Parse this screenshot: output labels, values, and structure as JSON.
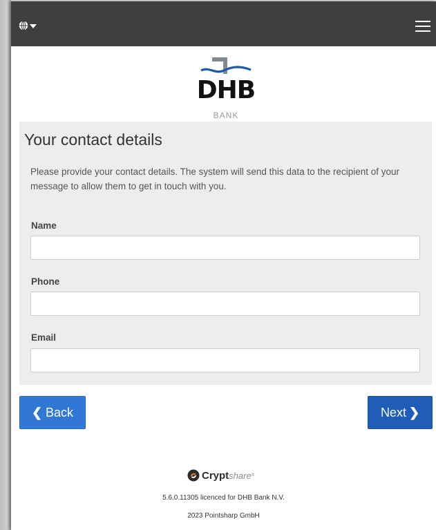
{
  "topbar": {
    "language_icon": "globe-icon",
    "language_caret_icon": "caret-down-icon",
    "menu_icon": "hamburger-menu-icon",
    "background": "#3f3f3f"
  },
  "logo": {
    "name": "DHB",
    "sub": "BANK"
  },
  "form": {
    "title": "Your contact details",
    "description": "Please provide your contact details. The system will send this data to the recipient of your message to allow them to get in touch with you.",
    "fields": [
      {
        "label": "Name",
        "value": ""
      },
      {
        "label": "Phone",
        "value": ""
      },
      {
        "label": "Email",
        "value": ""
      }
    ]
  },
  "buttons": {
    "back_label": "Back",
    "next_label": "Next",
    "back_icon": "chevron-left-icon",
    "next_icon": "chevron-right-icon",
    "back_color": "#3077d6",
    "next_color": "#1f5db6"
  },
  "footer": {
    "brand_bold": "Crypt",
    "brand_light": "share",
    "brand_mark": "®",
    "version": "5.6.0.11305 licenced for DHB Bank N.V.",
    "copyright": "2023 Pointsharp GmbH"
  }
}
